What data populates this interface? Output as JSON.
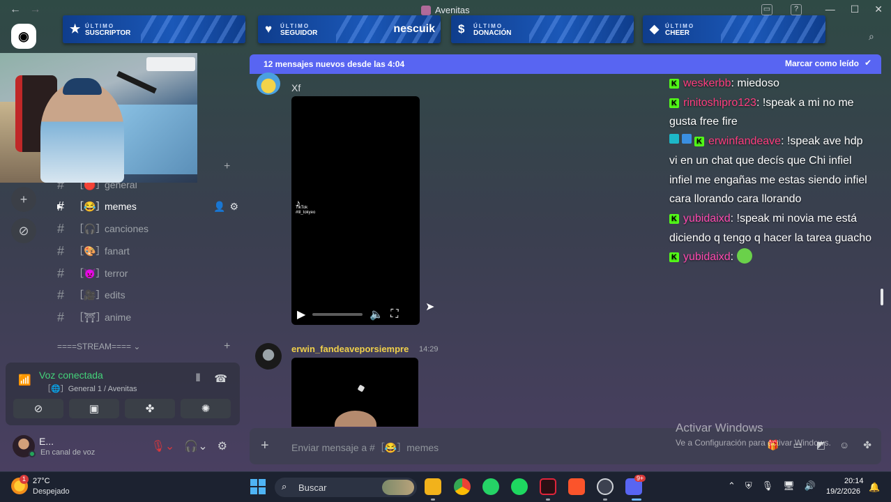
{
  "window": {
    "title": "Avenitas",
    "nav_back": "←",
    "nav_forward": "→",
    "minimize": "—",
    "maximize": "☐",
    "close": "✕"
  },
  "banners": [
    {
      "top": "ÚLTIMO",
      "bottom": "SUSCRIPTOR",
      "icon": "★",
      "value": ""
    },
    {
      "top": "ÚLTIMO",
      "bottom": "SEGUIDOR",
      "icon": "♥",
      "value": "nescuik"
    },
    {
      "top": "ÚLTIMO",
      "bottom": "DONACIÓN",
      "icon": "$",
      "value": ""
    },
    {
      "top": "ÚLTIMO",
      "bottom": "CHEER",
      "icon": "◆",
      "value": ""
    }
  ],
  "channels": [
    {
      "name": "general",
      "emoji": "［🔴］",
      "active": false
    },
    {
      "name": "memes",
      "emoji": "［😂］",
      "active": true
    },
    {
      "name": "canciones",
      "emoji": "［🎧］",
      "active": false
    },
    {
      "name": "fanart",
      "emoji": "［🎨］",
      "active": false
    },
    {
      "name": "terror",
      "emoji": "［👿］",
      "active": false
    },
    {
      "name": "edits",
      "emoji": "［🎥］",
      "active": false
    },
    {
      "name": "anime",
      "emoji": "［⛩］",
      "active": false
    }
  ],
  "category": {
    "stream": "====STREAM==== ⌄"
  },
  "voice": {
    "status": "Voz conectada",
    "channel": "［🌐］General 1 / Avenitas"
  },
  "user": {
    "name": "E...",
    "status": "En canal de voz"
  },
  "chat": {
    "new_messages": "12 mensajes nuevos desde las 4:04",
    "mark_read": "Marcar como leído",
    "message1": {
      "text": "Xf"
    },
    "tiktok_label": "TikTok",
    "tiktok_handle": "#lil_tokyeo",
    "message2": {
      "author": "erwin_fandeaveporsiempre",
      "time": "14:29"
    },
    "input_placeholder": "Enviar mensaje a #［😂］memes"
  },
  "stream_chat": [
    {
      "user": "weskerbb",
      "text": ": miedoso",
      "color": "pink",
      "extra_badge": false,
      "emote": false
    },
    {
      "user": "rinitoshipro123",
      "text": ": !speak a mi no me gusta free fire",
      "color": "pink",
      "extra_badge": false,
      "emote": false
    },
    {
      "user": "erwinfandeave",
      "text": ": !speak ave hdp vi en un chat que decís que Chi infiel infiel me engañas me estas siendo infiel cara llorando cara llorando",
      "color": "pink",
      "extra_badge": true,
      "emote": false
    },
    {
      "user": "yubidaixd",
      "text": ": !speak mi novia me está diciendo q tengo q hacer la tarea guacho",
      "color": "magenta",
      "extra_badge": false,
      "emote": false
    },
    {
      "user": "yubidaixd",
      "text": ": ",
      "color": "magenta",
      "extra_badge": false,
      "emote": true
    }
  ],
  "activate_windows": {
    "title": "Activar Windows",
    "subtitle": "Ve a Configuración para activar Windows."
  },
  "taskbar": {
    "weather_temp": "27°C",
    "weather_cond": "Despejado",
    "weather_badge": "1",
    "search": "Buscar",
    "time": "20:14",
    "date": "19/2/2026",
    "discord_badge": "9+"
  },
  "colors": {
    "accent": "#5865f2",
    "voice_green": "#44d37a",
    "kick_green": "#53fc18",
    "author_yellow": "#f0d04a",
    "banner_blue": "#1b58b8"
  }
}
